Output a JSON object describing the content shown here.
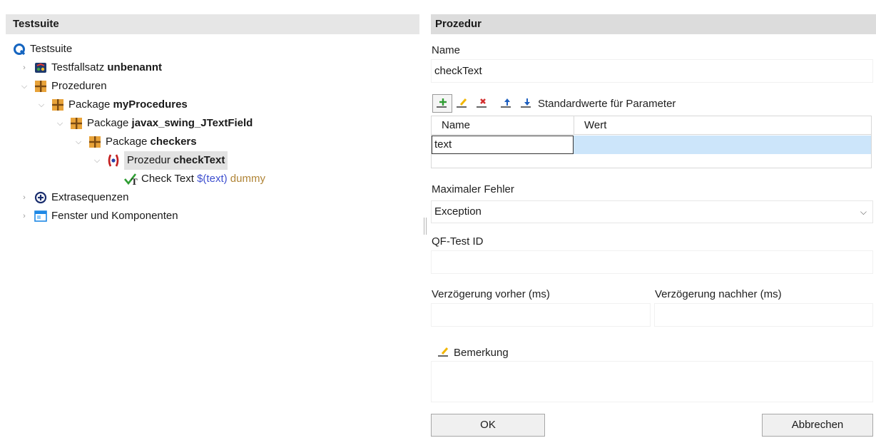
{
  "left": {
    "header": "Testsuite",
    "tree": [
      {
        "prefix": "Testsuite",
        "bold": "",
        "suffix_var": "",
        "suffix_dummy": "",
        "icon": "qftest-logo-icon"
      },
      {
        "prefix": "Testfallsatz ",
        "bold": "unbenannt",
        "icon": "testcase-set-icon"
      },
      {
        "prefix": "Prozeduren",
        "bold": "",
        "icon": "package-icon"
      },
      {
        "prefix": "Package ",
        "bold": "myProcedures",
        "icon": "package-icon"
      },
      {
        "prefix": "Package ",
        "bold": "javax_swing_JTextField",
        "icon": "package-icon"
      },
      {
        "prefix": "Package ",
        "bold": "checkers",
        "icon": "package-icon"
      },
      {
        "prefix": "Prozedur ",
        "bold": "checkText",
        "icon": "procedure-icon"
      },
      {
        "prefix": "Check Text ",
        "var": "$(text)",
        "dummy": " dummy",
        "icon": "check-icon"
      },
      {
        "prefix": "Extrasequenzen",
        "bold": "",
        "icon": "extras-icon"
      },
      {
        "prefix": "Fenster und Komponenten",
        "bold": "",
        "icon": "window-icon"
      }
    ]
  },
  "right": {
    "header": "Prozedur",
    "name_label": "Name",
    "name_value": "checkText",
    "params_label": "Standardwerte für Parameter",
    "table": {
      "columns": [
        "Name",
        "Wert"
      ],
      "rows": [
        {
          "name": "text",
          "value": ""
        }
      ]
    },
    "max_error_label": "Maximaler Fehler",
    "max_error_value": "Exception",
    "qf_id_label": "QF-Test ID",
    "delay_before_label": "Verzögerung vorher (ms)",
    "delay_after_label": "Verzögerung nachher (ms)",
    "comment_label": "Bemerkung",
    "ok_label": "OK",
    "cancel_label": "Abbrechen"
  },
  "colors": {
    "selection": "#cce5fa",
    "package_orange": "#e8a33a",
    "procedure_red": "#c42020",
    "var_blue": "#3e4fcf",
    "dummy_brown": "#b08436",
    "logo_blue": "#1565c0"
  }
}
